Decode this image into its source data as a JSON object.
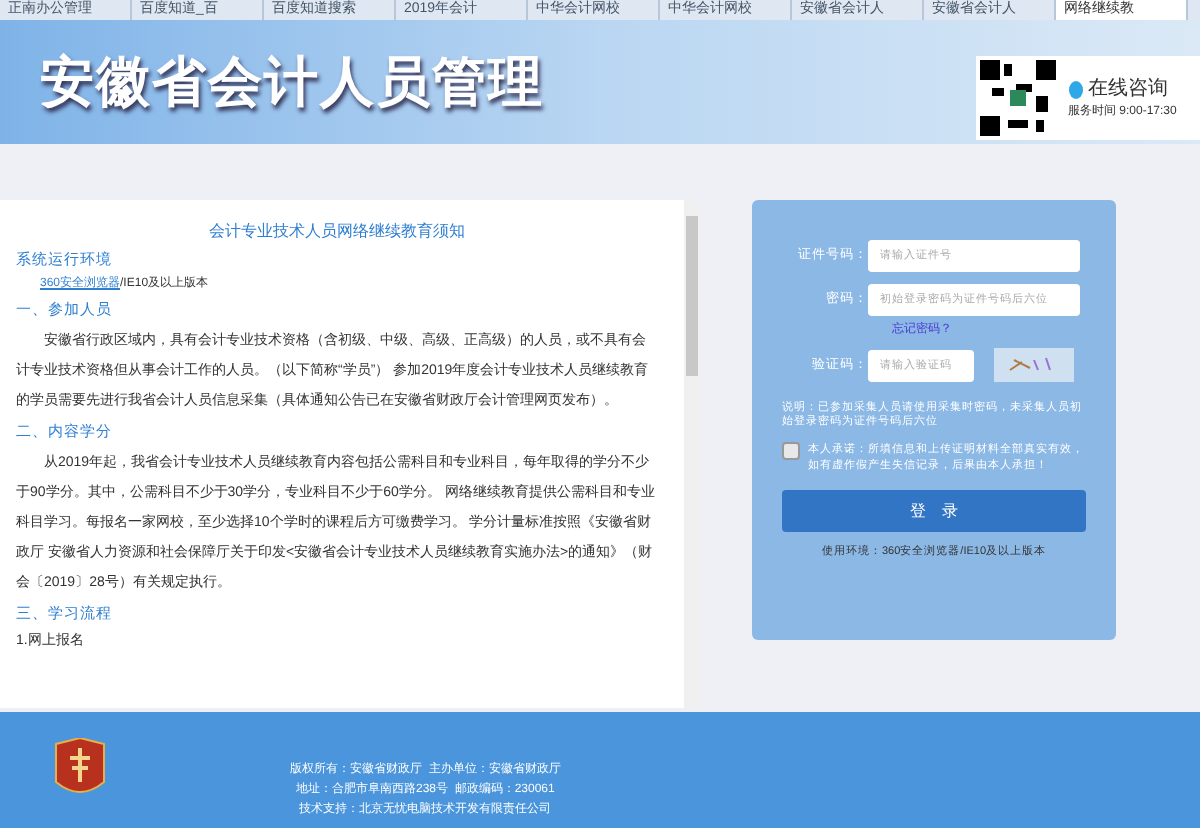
{
  "browser_tabs": [
    {
      "label": "正南办公管理",
      "selected": false
    },
    {
      "label": "百度知道_百",
      "selected": false
    },
    {
      "label": "百度知道搜索",
      "selected": false
    },
    {
      "label": "2019年会计",
      "selected": false
    },
    {
      "label": "中华会计网校",
      "selected": false
    },
    {
      "label": "中华会计网校",
      "selected": false
    },
    {
      "label": "安徽省会计人",
      "selected": false
    },
    {
      "label": "安徽省会计人",
      "selected": false
    },
    {
      "label": "网络继续教",
      "selected": true
    }
  ],
  "header": {
    "title": "安徽省会计人员管理",
    "consult": "在线咨询",
    "service_hours": "服务时间 9:00-17:30"
  },
  "notice": {
    "title": "会计专业技术人员网络继续教育须知",
    "blocks": [
      {
        "kind": "heading",
        "text": "系统运行环境"
      },
      {
        "kind": "env",
        "link": "360安全浏览器",
        "text": "/IE10及以上版本"
      },
      {
        "kind": "heading",
        "text": "一、参加人员"
      },
      {
        "kind": "para",
        "text": "安徽省行政区域内，具有会计专业技术资格（含初级、中级、高级、正高级）的人员，或不具有会计专业技术资格但从事会计工作的人员。（以下简称“学员”） 参加2019年度会计专业技术人员继续教育的学员需要先进行我省会计人员信息采集（具体通知公告已在安徽省财政厅会计管理网页发布）。"
      },
      {
        "kind": "heading",
        "text": "二、内容学分"
      },
      {
        "kind": "para",
        "text": "从2019年起，我省会计专业技术人员继续教育内容包括公需科目和专业科目，每年取得的学分不少于90学分。其中，公需科目不少于30学分，专业科目不少于60学分。 网络继续教育提供公需科目和专业科目学习。每报名一家网校，至少选择10个学时的课程后方可缴费学习。 学分计量标准按照《安徽省财政厅 安徽省人力资源和社会保障厅关于印发<安徽省会计专业技术人员继续教育实施办法>的通知》（财会〔2019〕28号）有关规定执行。"
      },
      {
        "kind": "heading",
        "text": "三、学习流程"
      },
      {
        "kind": "plain",
        "text": "1.网上报名"
      }
    ]
  },
  "login": {
    "fields": [
      {
        "label": "证件号码：",
        "placeholder": "请输入证件号"
      },
      {
        "label": "密码：",
        "placeholder": "初始登录密码为证件号码后六位"
      }
    ],
    "forgot": "忘记密码？",
    "captcha_label": "验证码：",
    "captcha_placeholder": "请输入验证码",
    "note": "说明：已参加采集人员请使用采集时密码，未采集人员初始登录密码为证件号码后六位",
    "pledge_checked": false,
    "pledge": "本人承诺：所填信息和上传证明材料全部真实有效，如有虚作假产生失信记录，后果由本人承担！",
    "button": "登　录",
    "env": "使用环境：360安全浏览器/IE10及以上版本"
  },
  "footer": {
    "lines": [
      "版权所有：安徽省财政厅  主办单位：安徽省财政厅",
      "地址：合肥市阜南西路238号  邮政编码：230061",
      "技术支持：北京无忧电脑技术开发有限责任公司"
    ]
  }
}
